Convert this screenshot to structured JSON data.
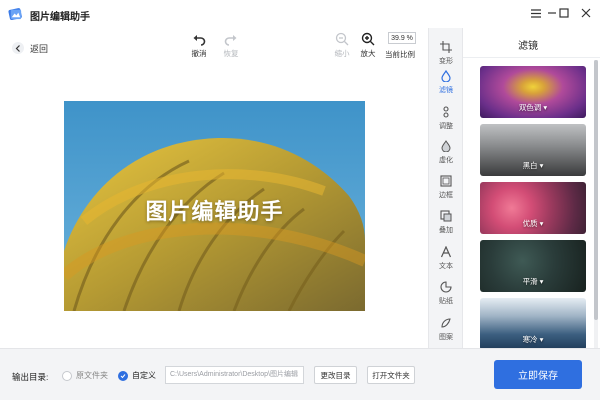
{
  "app": {
    "title": "图片编辑助手"
  },
  "toolbar": {
    "back_label": "返回",
    "undo_label": "撤消",
    "redo_label": "恢复",
    "zoom_out_label": "缩小",
    "zoom_in_label": "放大",
    "zoom_value": "39.9 %",
    "zoom_caption": "当前比例"
  },
  "canvas": {
    "watermark_text": "图片编辑助手"
  },
  "side_tools": [
    {
      "label": "变形",
      "icon": "crop-icon"
    },
    {
      "label": "滤镜",
      "icon": "filter-drop-icon",
      "active": true
    },
    {
      "label": "调整",
      "icon": "adjust-icon"
    },
    {
      "label": "虚化",
      "icon": "blur-drop-icon"
    },
    {
      "label": "边框",
      "icon": "frame-icon"
    },
    {
      "label": "叠加",
      "icon": "overlay-icon"
    },
    {
      "label": "文本",
      "icon": "text-icon"
    },
    {
      "label": "贴纸",
      "icon": "sticker-icon"
    },
    {
      "label": "图案",
      "icon": "pattern-icon"
    }
  ],
  "filter_panel": {
    "title": "滤镜",
    "filters": [
      {
        "label": "双色调"
      },
      {
        "label": "黑白"
      },
      {
        "label": "优质"
      },
      {
        "label": "平滑"
      },
      {
        "label": "寒冷"
      }
    ]
  },
  "output": {
    "label": "输出目录:",
    "option_original": "原文件夹",
    "option_custom": "自定义",
    "selected": "custom",
    "path_value": "C:\\Users\\Administrator\\Desktop\\图片编辑",
    "change_dir_label": "更改目录",
    "open_folder_label": "打开文件夹",
    "save_label": "立即保存"
  },
  "colors": {
    "accent": "#2f6fe0",
    "sidebar_bg": "#f3f4f6"
  }
}
